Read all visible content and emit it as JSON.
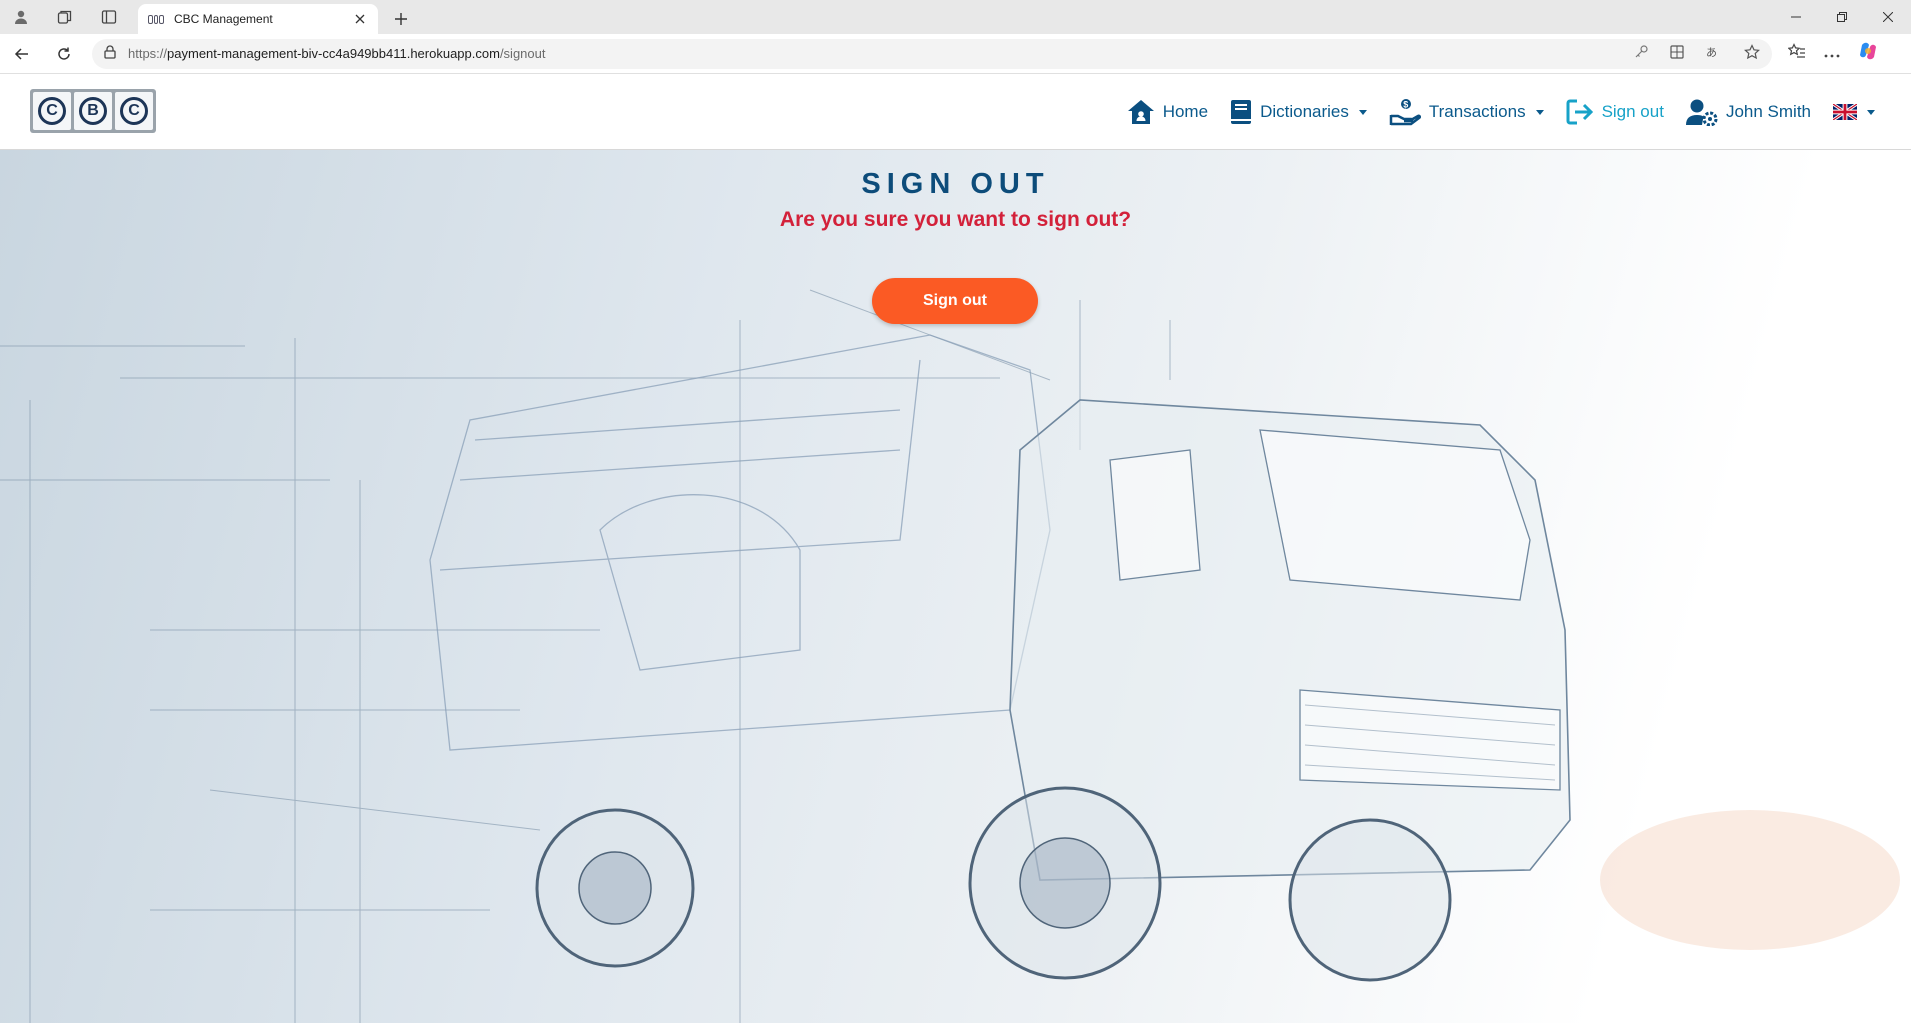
{
  "browser": {
    "tab_title": "CBC Management",
    "url_scheme": "https://",
    "url_host": "payment-management-biv-cc4a949bb411.herokuapp.com",
    "url_path": "/signout"
  },
  "nav": {
    "logo_letters": [
      "C",
      "B",
      "C"
    ],
    "home": "Home",
    "dictionaries": "Dictionaries",
    "transactions": "Transactions",
    "signout": "Sign out",
    "user": "John Smith",
    "language_flag": "uk-flag-icon"
  },
  "main": {
    "heading": "SIGN OUT",
    "question": "Are you sure you want to sign out?",
    "button_label": "Sign out"
  },
  "colors": {
    "nav_link": "#0b5a8c",
    "signout_link": "#17a2c8",
    "heading": "#0d4c7a",
    "question": "#d3213a",
    "button": "#fb5a24"
  }
}
